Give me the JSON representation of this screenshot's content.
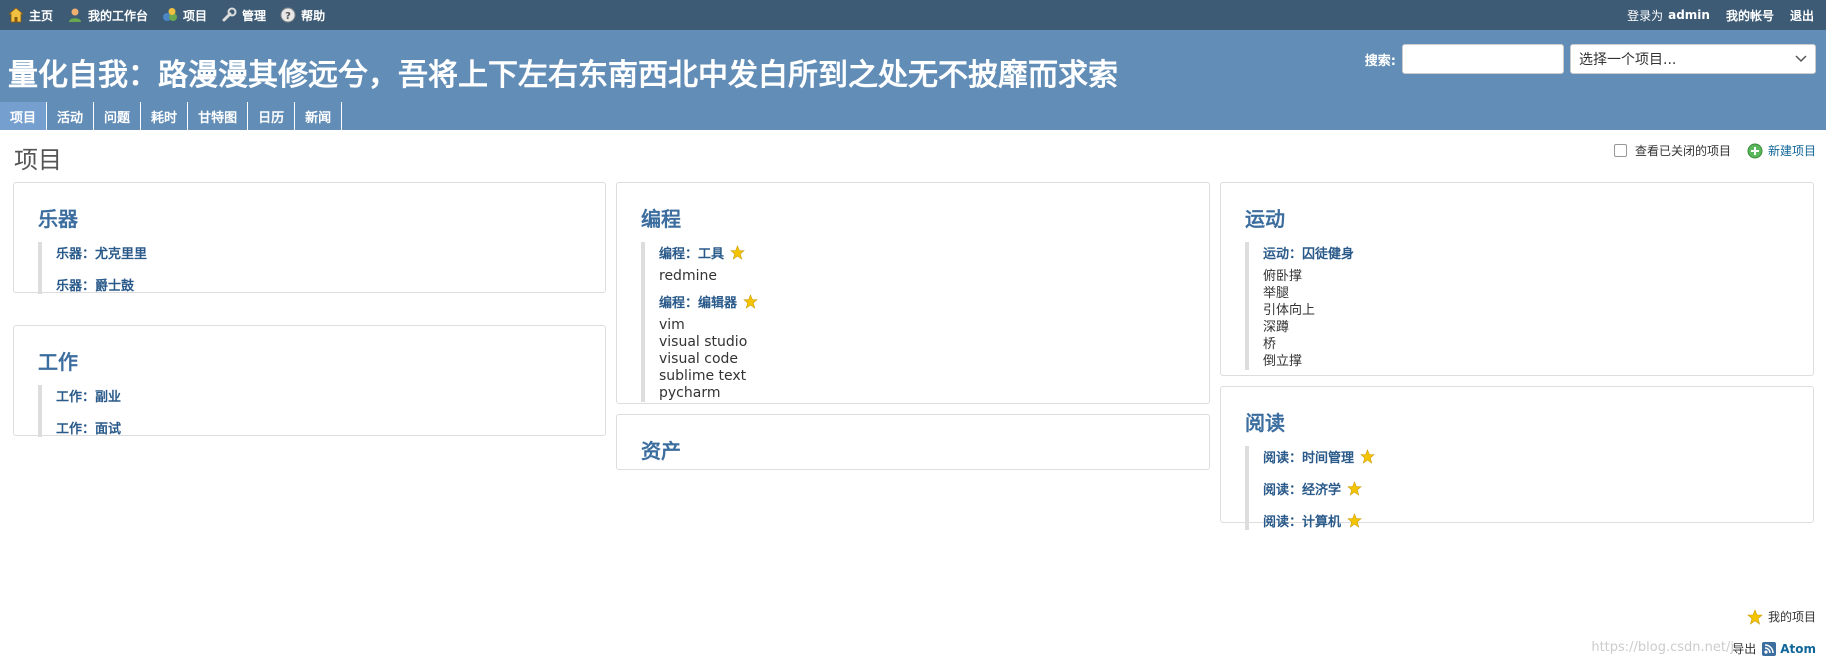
{
  "top_menu": {
    "items": [
      {
        "label": "主页",
        "icon": "home-icon"
      },
      {
        "label": "我的工作台",
        "icon": "user-icon"
      },
      {
        "label": "项目",
        "icon": "projects-icon"
      },
      {
        "label": "管理",
        "icon": "wrench-icon"
      },
      {
        "label": "帮助",
        "icon": "help-icon"
      }
    ],
    "logged_in_prefix": "登录为",
    "username": "admin",
    "my_account": "我的帐号",
    "logout": "退出"
  },
  "header": {
    "title": "量化自我：路漫漫其修远兮，吾将上下左右东南西北中发白所到之处无不披靡而求索",
    "search_label": "搜索:",
    "search_value": "",
    "project_jump": "选择一个项目..."
  },
  "main_menu": {
    "tabs": [
      "项目",
      "活动",
      "问题",
      "耗时",
      "甘特图",
      "日历",
      "新闻"
    ],
    "selected": 0
  },
  "content": {
    "title": "项目",
    "closed_projects_label": "查看已关闭的项目",
    "new_project_label": "新建项目"
  },
  "projects": {
    "col1": [
      {
        "title": "乐器",
        "children": [
          {
            "label": "乐器：尤克里里",
            "star": false,
            "items": []
          },
          {
            "label": "乐器：爵士鼓",
            "star": false,
            "items": []
          }
        ]
      },
      {
        "title": "工作",
        "children": [
          {
            "label": "工作：副业",
            "star": false,
            "items": []
          },
          {
            "label": "工作：面试",
            "star": false,
            "items": []
          }
        ]
      }
    ],
    "col2": [
      {
        "title": "编程",
        "children": [
          {
            "label": "编程：工具",
            "star": true,
            "items": [
              "redmine"
            ]
          },
          {
            "label": "编程：编辑器",
            "star": true,
            "items": [
              "vim",
              "visual studio",
              "visual code",
              "sublime text",
              "pycharm"
            ]
          }
        ]
      },
      {
        "title": "资产",
        "children": []
      }
    ],
    "col3": [
      {
        "title": "运动",
        "children": [
          {
            "label": "运动：囚徒健身",
            "star": false,
            "items": [
              "俯卧撑",
              "举腿",
              "引体向上",
              "深蹲",
              "桥",
              "倒立撑"
            ]
          }
        ]
      },
      {
        "title": "阅读",
        "children": [
          {
            "label": "阅读：时间管理",
            "star": true,
            "items": []
          },
          {
            "label": "阅读：经济学",
            "star": true,
            "items": []
          },
          {
            "label": "阅读：计算机",
            "star": true,
            "items": []
          }
        ]
      }
    ]
  },
  "footer": {
    "legend_label": "我的项目",
    "export_label": "导出",
    "atom_label": "Atom",
    "watermark": "https://blog.csdn.net/j"
  },
  "colors": {
    "top_bar": "#3e5b76",
    "header": "#628db6",
    "tab_selected": "#759fcf",
    "link": "#2a5a8a",
    "star": "#f5c400"
  }
}
